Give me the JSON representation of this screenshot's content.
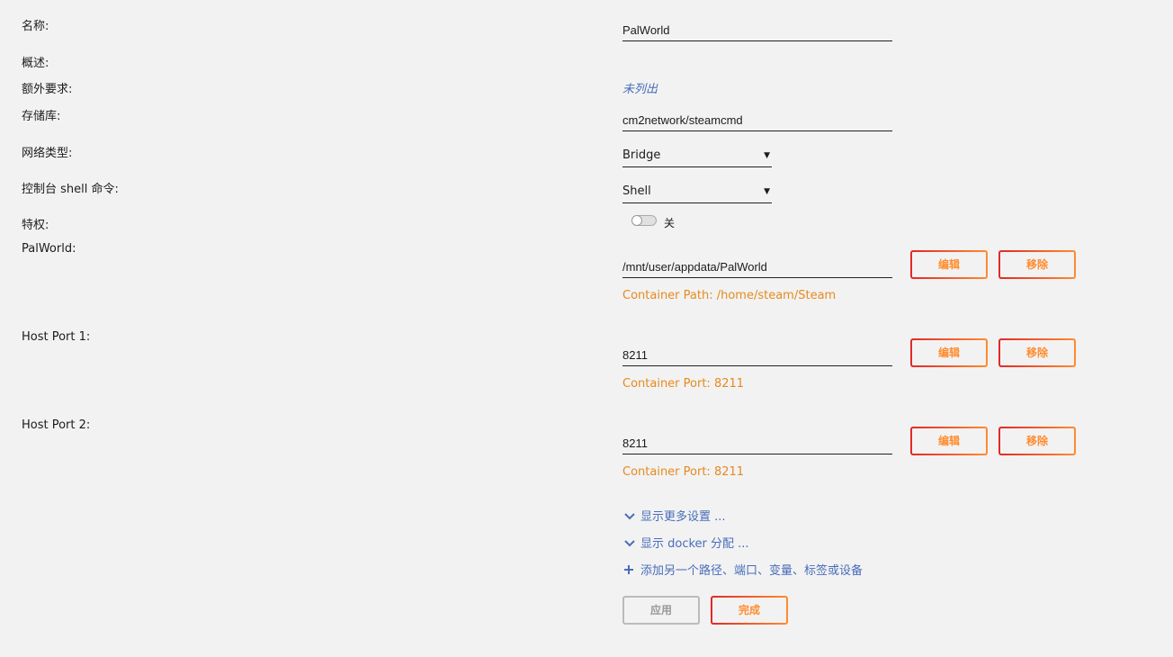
{
  "labels": {
    "name": "名称:",
    "overview": "概述:",
    "requirements": "额外要求:",
    "repository": "存储库:",
    "network_type": "网络类型:",
    "console_shell": "控制台 shell 命令:",
    "privileged": "特权:",
    "palworld": "PalWorld:",
    "host_port_1": "Host Port 1:",
    "host_port_2": "Host Port 2:"
  },
  "fields": {
    "name": "PalWorld",
    "requirements": "未列出",
    "repository": "cm2network/steamcmd",
    "network_type": "Bridge",
    "console_shell": "Shell",
    "privileged_state": "关",
    "palworld_path": "/mnt/user/appdata/PalWorld",
    "palworld_note": "Container Path: /home/steam/Steam",
    "host_port_1": "8211",
    "host_port_1_note": "Container Port: 8211",
    "host_port_2": "8211",
    "host_port_2_note": "Container Port: 8211"
  },
  "buttons": {
    "edit": "编辑",
    "remove": "移除",
    "apply": "应用",
    "done": "完成"
  },
  "links": {
    "more_settings": "显示更多设置 ...",
    "docker_alloc": "显示 docker 分配 ...",
    "add_another": "添加另一个路径、端口、变量、标签或设备"
  },
  "colors": {
    "accent_orange": "#ff8c2f",
    "accent_red": "#e22828",
    "link_blue": "#486dba",
    "background": "#f2f2f2"
  }
}
